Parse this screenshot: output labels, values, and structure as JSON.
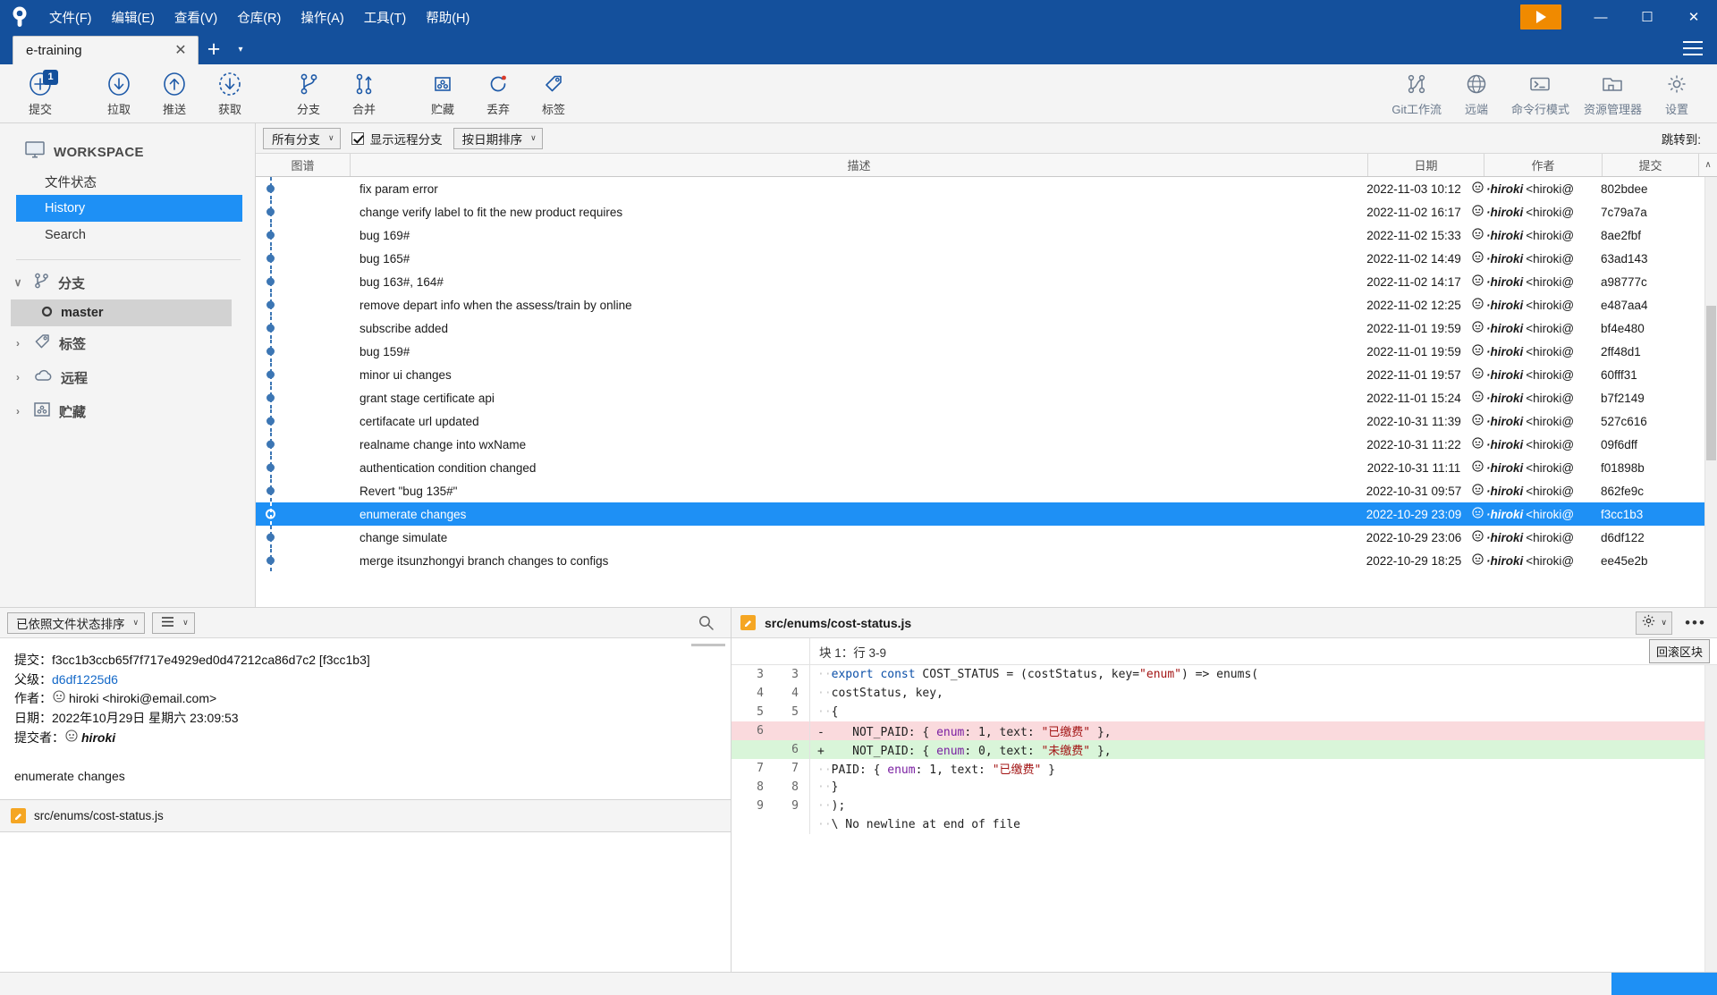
{
  "titlebar": {
    "logo_icon": "sourcetree-logo-icon",
    "menus": [
      "文件(F)",
      "编辑(E)",
      "查看(V)",
      "仓库(R)",
      "操作(A)",
      "工具(T)",
      "帮助(H)"
    ],
    "play_icon": "play-icon",
    "minimize_icon": "minimize-icon",
    "maximize_icon": "maximize-icon",
    "close_icon": "close-icon",
    "minimize_glyph": "—",
    "maximize_glyph": "☐",
    "close_glyph": "✕"
  },
  "tabs": {
    "items": [
      {
        "label": "e-training",
        "close_glyph": "✕"
      }
    ],
    "new_tab_glyph": "+",
    "dropdown_glyph": "▾",
    "menu_icon": "hamburger-menu-icon"
  },
  "toolbar": {
    "left": [
      {
        "label": "提交",
        "icon": "commit-icon",
        "badge": "1"
      },
      {
        "label": "拉取",
        "icon": "pull-icon"
      },
      {
        "label": "推送",
        "icon": "push-icon"
      },
      {
        "label": "获取",
        "icon": "fetch-icon"
      },
      {
        "label": "分支",
        "icon": "branch-icon"
      },
      {
        "label": "合并",
        "icon": "merge-icon"
      },
      {
        "label": "贮藏",
        "icon": "stash-icon"
      },
      {
        "label": "丢弃",
        "icon": "discard-icon"
      },
      {
        "label": "标签",
        "icon": "tag-icon"
      }
    ],
    "right": [
      {
        "label": "Git工作流",
        "icon": "gitflow-icon"
      },
      {
        "label": "远端",
        "icon": "globe-icon"
      },
      {
        "label": "命令行模式",
        "icon": "terminal-icon"
      },
      {
        "label": "资源管理器",
        "icon": "explorer-icon"
      },
      {
        "label": "设置",
        "icon": "gear-icon"
      }
    ]
  },
  "sidebar": {
    "workspace": {
      "label": "WORKSPACE",
      "icon": "monitor-icon"
    },
    "links": [
      {
        "label": "文件状态",
        "active": false
      },
      {
        "label": "History",
        "active": true
      },
      {
        "label": "Search",
        "active": false
      }
    ],
    "groups": [
      {
        "label": "分支",
        "icon": "branch-icon",
        "expanded": true,
        "chevron": "∨",
        "children": [
          {
            "label": "master",
            "icon": "branch-node-icon",
            "selected": true
          }
        ]
      },
      {
        "label": "标签",
        "icon": "tag-icon",
        "expanded": false,
        "chevron": "›",
        "children": []
      },
      {
        "label": "远程",
        "icon": "cloud-icon",
        "expanded": false,
        "chevron": "›",
        "children": []
      },
      {
        "label": "贮藏",
        "icon": "stash-icon",
        "expanded": false,
        "chevron": "›",
        "children": []
      }
    ]
  },
  "filterbar": {
    "branch_select": "所有分支",
    "show_remote_label": "显示远程分支",
    "show_remote_checked": true,
    "sort_select": "按日期排序",
    "jump_to_label": "跳转到:",
    "caret_glyph": "∨"
  },
  "commit_table": {
    "headers": {
      "graph": "图谱",
      "description": "描述",
      "date": "日期",
      "author": "作者",
      "commit": "提交"
    },
    "sort_arrow": "∧",
    "rows": [
      {
        "description": "fix param error",
        "date": "2022-11-03 10:12",
        "author": "hiroki",
        "author_email": "<hiroki@",
        "hash": "802bdee",
        "selected": false
      },
      {
        "description": "change verify label to fit the new product requires",
        "date": "2022-11-02 16:17",
        "author": "hiroki",
        "author_email": "<hiroki@",
        "hash": "7c79a7a",
        "selected": false
      },
      {
        "description": "bug 169#",
        "date": "2022-11-02 15:33",
        "author": "hiroki",
        "author_email": "<hiroki@",
        "hash": "8ae2fbf",
        "selected": false
      },
      {
        "description": "bug 165#",
        "date": "2022-11-02 14:49",
        "author": "hiroki",
        "author_email": "<hiroki@",
        "hash": "63ad143",
        "selected": false
      },
      {
        "description": "bug 163#, 164#",
        "date": "2022-11-02 14:17",
        "author": "hiroki",
        "author_email": "<hiroki@",
        "hash": "a98777c",
        "selected": false
      },
      {
        "description": "remove depart info when the assess/train by online",
        "date": "2022-11-02 12:25",
        "author": "hiroki",
        "author_email": "<hiroki@",
        "hash": "e487aa4",
        "selected": false
      },
      {
        "description": "subscribe added",
        "date": "2022-11-01 19:59",
        "author": "hiroki",
        "author_email": "<hiroki@",
        "hash": "bf4e480",
        "selected": false
      },
      {
        "description": "bug 159#",
        "date": "2022-11-01 19:59",
        "author": "hiroki",
        "author_email": "<hiroki@",
        "hash": "2ff48d1",
        "selected": false
      },
      {
        "description": "minor ui changes",
        "date": "2022-11-01 19:57",
        "author": "hiroki",
        "author_email": "<hiroki@",
        "hash": "60fff31",
        "selected": false
      },
      {
        "description": "grant stage certificate api",
        "date": "2022-11-01 15:24",
        "author": "hiroki",
        "author_email": "<hiroki@",
        "hash": "b7f2149",
        "selected": false
      },
      {
        "description": "certifacate url updated",
        "date": "2022-10-31 11:39",
        "author": "hiroki",
        "author_email": "<hiroki@",
        "hash": "527c616",
        "selected": false
      },
      {
        "description": "realname change into wxName",
        "date": "2022-10-31 11:22",
        "author": "hiroki",
        "author_email": "<hiroki@",
        "hash": "09f6dff",
        "selected": false
      },
      {
        "description": "authentication condition changed",
        "date": "2022-10-31 11:11",
        "author": "hiroki",
        "author_email": "<hiroki@",
        "hash": "f01898b",
        "selected": false
      },
      {
        "description": "Revert \"bug 135#\"",
        "date": "2022-10-31 09:57",
        "author": "hiroki",
        "author_email": "<hiroki@",
        "hash": "862fe9c",
        "selected": false
      },
      {
        "description": "enumerate changes",
        "date": "2022-10-29 23:09",
        "author": "hiroki",
        "author_email": "<hiroki@",
        "hash": "f3cc1b3",
        "selected": true
      },
      {
        "description": "change simulate",
        "date": "2022-10-29 23:06",
        "author": "hiroki",
        "author_email": "<hiroki@",
        "hash": "d6df122",
        "selected": false
      },
      {
        "description": "merge itsunzhongyi branch changes to configs",
        "date": "2022-10-29 18:25",
        "author": "hiroki",
        "author_email": "<hiroki@",
        "hash": "ee45e2b",
        "selected": false
      }
    ]
  },
  "detail_panel": {
    "sort_select": "已依照文件状态排序",
    "view_icon": "list-view-icon",
    "search_icon": "search-icon",
    "caret_glyph": "∨",
    "fields": [
      {
        "key": "提交：",
        "value": "f3cc1b3ccb65f7f717e4929ed0d47212ca86d7c2 [f3cc1b3]",
        "link": false
      },
      {
        "key": "父级：",
        "value": "d6df1225d6",
        "link": true
      },
      {
        "key": "作者：",
        "value": "hiroki <hiroki@email.com>",
        "link": false,
        "avatar": true
      },
      {
        "key": "日期：",
        "value": "2022年10月29日 星期六 23:09:53",
        "link": false
      },
      {
        "key": "提交者：",
        "value": "hiroki",
        "link": false,
        "avatar": true
      }
    ],
    "message": "enumerate changes",
    "file_item": {
      "label": "src/enums/cost-status.js",
      "icon": "edit-file-icon"
    }
  },
  "diff_panel": {
    "file_name": "src/enums/cost-status.js",
    "file_icon": "edit-file-icon",
    "gear_icon": "gear-icon",
    "gear_caret": "∨",
    "more_icon": "more-options-icon",
    "more_glyph": "•••",
    "hunk_label": "块 1：行 3-9",
    "rollback_label": "回滚区块",
    "lines": [
      {
        "old": "3",
        "new": "3",
        "type": "ctx",
        "code": "export const COST_STATUS = (costStatus, key=\"enum\") => enums("
      },
      {
        "old": "4",
        "new": "4",
        "type": "ctx",
        "code": "costStatus, key,"
      },
      {
        "old": "5",
        "new": "5",
        "type": "ctx",
        "code": "{"
      },
      {
        "old": "6",
        "new": "",
        "type": "del",
        "code": "-    NOT_PAID: { enum: 1, text: \"已缴费\" },"
      },
      {
        "old": "",
        "new": "6",
        "type": "add",
        "code": "+    NOT_PAID: { enum: 0, text: \"未缴费\" },"
      },
      {
        "old": "7",
        "new": "7",
        "type": "ctx",
        "code": "PAID: { enum: 1, text: \"已缴费\" }"
      },
      {
        "old": "8",
        "new": "8",
        "type": "ctx",
        "code": "}"
      },
      {
        "old": "9",
        "new": "9",
        "type": "ctx",
        "code": ");"
      },
      {
        "old": "",
        "new": "",
        "type": "ctx",
        "code": "\\ No newline at end of file"
      }
    ]
  },
  "colors": {
    "titlebar": "#14509c",
    "accent_selection": "#1e90f5",
    "toolbar_icon": "#1e5aa8",
    "diff_add": "#d9f5d9",
    "diff_del": "#fadadd",
    "orange": "#f08a00"
  }
}
